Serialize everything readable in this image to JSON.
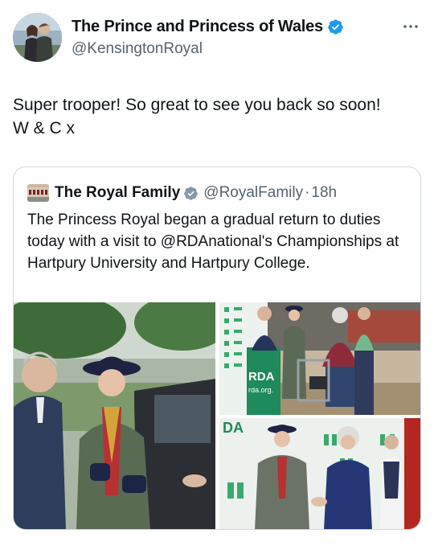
{
  "tweet": {
    "author": {
      "display_name": "The Prince and Princess of Wales",
      "handle": "@KensingtonRoyal",
      "verified": true,
      "avatar_icon": "couple-photo-avatar"
    },
    "text": "Super trooper! So great to see you back so soon!\nW & C x",
    "more_icon": "more-options-icon"
  },
  "quoted_tweet": {
    "author": {
      "display_name": "The Royal Family",
      "handle": "@RoyalFamily",
      "verified": true,
      "avatar_icon": "palace-avatar"
    },
    "separator": "·",
    "time": "18h",
    "text": "The Princess Royal began a gradual return to duties today with a visit to @RDAnational's Championships at Hartpury University and Hartpury College.",
    "media": [
      {
        "name": "photo-arrival",
        "description_icon": "photo"
      },
      {
        "name": "photo-presentation",
        "sign_text": "RDA",
        "sign_subtext": "rda.org.",
        "description_icon": "photo"
      },
      {
        "name": "photo-meeting",
        "sign_text": "DA",
        "description_icon": "photo"
      }
    ]
  },
  "colors": {
    "verified_blue": "#1d9bf0",
    "secondary_text": "#536471",
    "border": "#cfd9de",
    "rda_green": "#1f8a5b"
  }
}
